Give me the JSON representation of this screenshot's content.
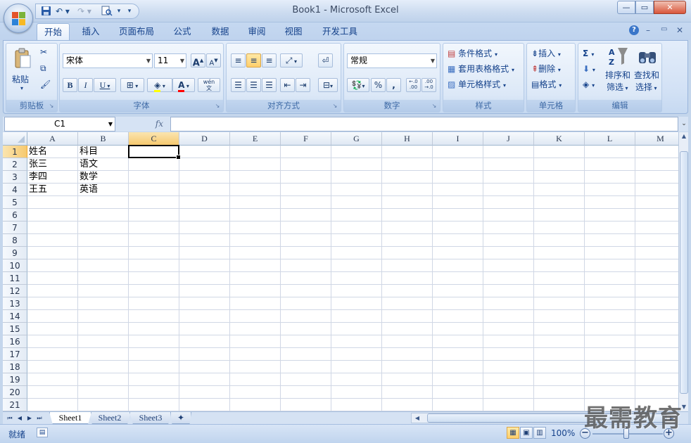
{
  "app": {
    "title": "Book1 - Microsoft Excel",
    "title_extra": "Book1 - Microsoft Excel"
  },
  "window_controls": {
    "min": "—",
    "restore": "▭",
    "close": "✕"
  },
  "ribbon_controls": {
    "help": "?",
    "min": "–",
    "restore": "▭",
    "close": "✕"
  },
  "tabs": [
    "开始",
    "插入",
    "页面布局",
    "公式",
    "数据",
    "审阅",
    "视图",
    "开发工具"
  ],
  "clipboard": {
    "paste": "粘贴",
    "label": "剪贴板"
  },
  "font": {
    "name": "宋体",
    "size": "11",
    "grow": "A",
    "shrink": "A",
    "bold": "B",
    "italic": "I",
    "underline": "U",
    "wen": "wén\n文",
    "label": "字体"
  },
  "alignment": {
    "label": "对齐方式"
  },
  "number": {
    "format": "常规",
    "percent": "%",
    "comma": ",",
    "inc": ".0\n.00",
    "dec": ".00\n.0",
    "label": "数字"
  },
  "styles": {
    "conditional": "条件格式",
    "table": "套用表格格式",
    "cell": "单元格样式",
    "label": "样式"
  },
  "cells": {
    "insert": "插入",
    "delete": "删除",
    "format": "格式",
    "label": "单元格"
  },
  "editing": {
    "sum": "Σ",
    "sort": "排序和",
    "sort2": "筛选",
    "find": "查找和",
    "find2": "选择",
    "label": "编辑"
  },
  "namebox": {
    "value": "C1"
  },
  "fx": "fx",
  "columns": [
    "A",
    "B",
    "C",
    "D",
    "E",
    "F",
    "G",
    "H",
    "I",
    "J",
    "K",
    "L",
    "M"
  ],
  "rows": [
    "1",
    "2",
    "3",
    "4",
    "5",
    "6",
    "7",
    "8",
    "9",
    "10",
    "11",
    "12",
    "13",
    "14",
    "15",
    "16",
    "17",
    "18",
    "19",
    "20",
    "21"
  ],
  "cells_data": {
    "A1": "姓名",
    "B1": "科目",
    "A2": "张三",
    "B2": "语文",
    "A3": "李四",
    "B3": "数学",
    "A4": "王五",
    "B4": "英语"
  },
  "sheets": [
    "Sheet1",
    "Sheet2",
    "Sheet3"
  ],
  "status": {
    "ready": "就绪",
    "zoom": "100%"
  },
  "watermark": "最需教育"
}
